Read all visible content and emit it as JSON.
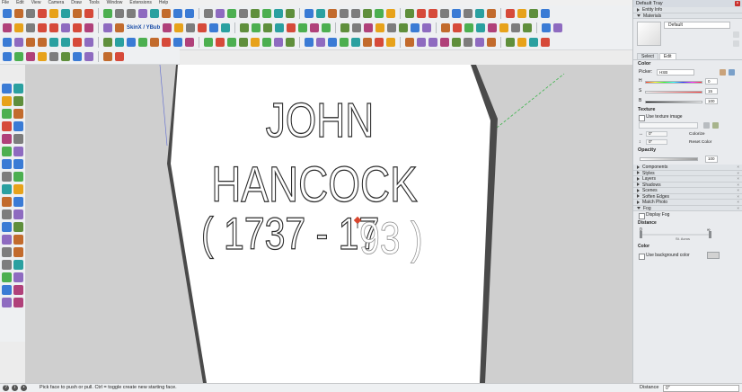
{
  "menu": [
    "File",
    "Edit",
    "View",
    "Camera",
    "Draw",
    "Tools",
    "Window",
    "Extensions",
    "Help"
  ],
  "toolbar": {
    "row1_icons": [
      "select-icon",
      "push-pull-icon",
      "move-icon",
      "rotate-icon",
      "scale-icon",
      "offset-icon",
      "tape-icon",
      "text-icon",
      "axes-icon",
      "dim-icon",
      "protractor-icon",
      "3dtext-icon",
      "orbit-icon",
      "pan-icon",
      "zoom-icon",
      "zoom-window-icon",
      "zoom-extents-icon",
      "previous-icon",
      "next-icon",
      "iso-icon",
      "top-icon",
      "front-icon",
      "right-icon",
      "back-icon",
      "left-icon",
      "bottom-icon",
      "xray-icon",
      "wireframe-icon",
      "hidden-icon",
      "shaded-icon",
      "textured-icon",
      "mono-icon",
      "section-icon",
      "shadow-icon",
      "fog-icon",
      "edges-icon",
      "profiles-icon",
      "extension-icon",
      "sandbox-icon",
      "drape-icon",
      "stamp-icon",
      "flip-icon",
      "terrain-icon",
      "contour-icon",
      "photo-icon",
      "warehouse-icon",
      "components-icon",
      "share-icon"
    ],
    "row2_icons": [
      "undo-icon",
      "redo-icon",
      "play-icon",
      "record-icon",
      "dot-icon",
      "back-icon",
      "forward-icon",
      "tag-icon",
      "layer-icon",
      "scene-icon",
      "grid-icon",
      "skin-icon",
      "hide-icon",
      "unhide-icon",
      "lock-icon",
      "unlock-icon",
      "group-icon",
      "explode-icon",
      "intersect-icon",
      "trim-icon",
      "split-icon",
      "union-icon",
      "subtract-icon",
      "follow-me-icon",
      "outer-shell-icon",
      "solid-icon",
      "tool-a-icon",
      "tool-b-icon",
      "tool-c-icon",
      "tool-d-icon",
      "tool-e-icon",
      "tool-f-icon",
      "tool-g-icon",
      "tool-h-icon",
      "tool-i-icon",
      "tool-j-icon",
      "tool-k-icon",
      "tool-l-icon",
      "tool-m-icon",
      "tool-n-icon",
      "tool-o-icon",
      "tool-p-icon",
      "info-icon",
      "settings-icon",
      "ruby-icon"
    ],
    "row3_icons": [
      "select-icon",
      "eraser-icon",
      "pencil-icon",
      "arc-icon",
      "rectangle-icon",
      "circle-icon",
      "polygon-icon",
      "freehand-icon",
      "push-pull-icon",
      "move-icon",
      "rotate-icon",
      "scale-icon",
      "follow-icon",
      "offset-icon",
      "tape-icon",
      "dimension-icon",
      "protractor-icon",
      "text-icon",
      "axes-icon",
      "3dtext-icon",
      "section-icon",
      "orbit-icon",
      "pan-icon",
      "zoom-icon",
      "walk-icon",
      "look-icon",
      "position-icon",
      "sandbox-icon",
      "contour-icon",
      "drape-icon",
      "stamp-icon",
      "flip-icon",
      "smoove-icon",
      "add-detail-icon",
      "terrain-icon",
      "warehouse-icon",
      "share-icon",
      "extension-icon",
      "match-icon",
      "photo-icon",
      "fog-icon",
      "edge-icon",
      "style-icon",
      "layers-icon",
      "outliner-icon",
      "entity-icon",
      "scene-icon",
      "component-icon",
      "material-icon"
    ],
    "row4_icons": [
      "sphere-icon",
      "globe-icon",
      "plugin-a-icon",
      "plugin-b-icon",
      "plugin-c-icon",
      "plugin-d-icon",
      "plugin-e-icon",
      "plugin-f-icon",
      "plugin-g-icon",
      "plugin-h-icon"
    ],
    "skin_label": "SkinX / YBub"
  },
  "left_toolbar": [
    "select-icon",
    "eraser-icon",
    "paint-icon",
    "pencil-icon",
    "line-icon",
    "arc-icon",
    "rectangle-icon",
    "shape-icon",
    "circle-icon",
    "polygon-icon",
    "freehand-icon",
    "arc3-icon",
    "move-icon",
    "push-pull-icon",
    "rotate-icon",
    "follow-me-icon",
    "scale-icon",
    "offset-icon",
    "tape-icon",
    "dim-icon",
    "protractor-icon",
    "text-icon",
    "axes-icon",
    "3dtext-icon",
    "orbit-icon",
    "pan-icon",
    "zoom-icon",
    "zoom-window-icon",
    "zoom-extents-icon",
    "previous-icon",
    "position-icon",
    "walk-icon",
    "look-icon",
    "section-icon",
    "walk2-icon",
    "look2-icon"
  ],
  "viewport": {
    "text_line1": "JOHN",
    "text_line2": "HANCOCK",
    "text_line3_solid": "( 1737 - 17",
    "text_line3_outline": "93 )"
  },
  "status": {
    "message": "Pick face to push or pull.  Ctrl = toggle create new starting face.",
    "distance_label": "Distance",
    "distance_value": "0\""
  },
  "tray": {
    "title": "Default Tray",
    "entity_info": "Entity Info",
    "materials": "Materials",
    "material_name": "Default",
    "tabs": [
      "Select",
      "Edit"
    ],
    "color_label": "Color",
    "picker_label": "Picker:",
    "picker_value": "HSB",
    "h_label": "H",
    "h_value": "0",
    "s_label": "S",
    "s_value": "15",
    "b_label": "B",
    "b_value": "100",
    "texture_label": "Texture",
    "use_texture": "Use texture image",
    "tex_w": "0\"",
    "tex_h": "0\"",
    "colorize": "Colorize",
    "reset_color": "Reset Color",
    "opacity_label": "Opacity",
    "opacity_value": "100",
    "panels": [
      "Components",
      "Styles",
      "Layers",
      "Shadows",
      "Scenes",
      "Soften Edges",
      "Match Photo",
      "Fog"
    ],
    "display_fog": "Display Fog",
    "distance_label": "Distance",
    "fog_zero": "0",
    "fog_inf": "∞",
    "fog_scale": "St. Acros",
    "fog_color_label": "Color",
    "use_bg_color": "Use background color",
    "colors": {
      "h": 0,
      "s": 15,
      "b": 100
    }
  }
}
